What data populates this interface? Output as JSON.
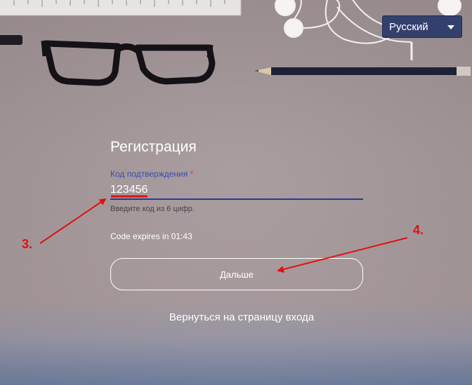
{
  "language_select": {
    "selected": "Русский",
    "icon": "chevron-down-icon"
  },
  "form": {
    "title": "Регистрация",
    "code_label": "Код подтверждения",
    "required_mark": "*",
    "code_value": "123456",
    "hint": "Введите код из 6 цифр.",
    "expires": "Code expires in 01:43",
    "next_label": "Дальше",
    "back_link": "Вернуться на страницу входа"
  },
  "annotations": {
    "step3": "3.",
    "step4": "4.",
    "color": "#e0110f"
  },
  "colors": {
    "accent": "#34406c",
    "label": "#3b4ba8",
    "required": "#d44a4a"
  }
}
